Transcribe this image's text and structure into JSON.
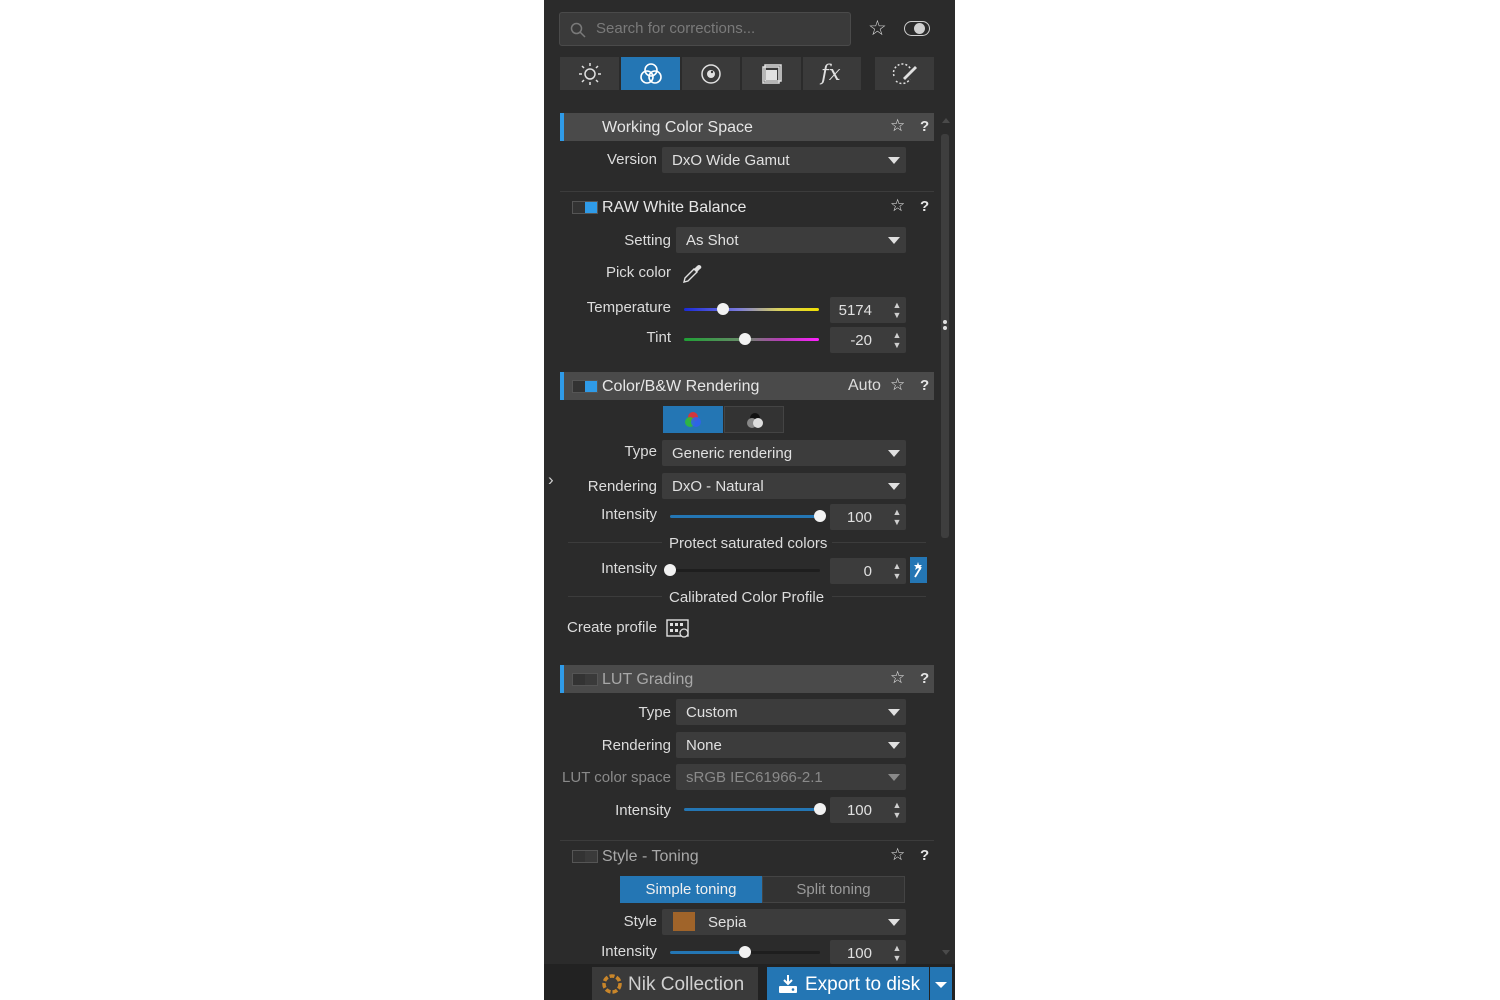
{
  "search": {
    "placeholder": "Search for corrections..."
  },
  "tabs": [
    {
      "icon": "sun-icon"
    },
    {
      "icon": "color-circles-icon"
    },
    {
      "icon": "lens-icon"
    },
    {
      "icon": "frames-icon"
    },
    {
      "icon": "fx-icon",
      "label": "fx"
    },
    {
      "icon": "local-adjust-icon"
    }
  ],
  "working_color_space": {
    "title": "Working Color Space",
    "version_label": "Version",
    "version_value": "DxO Wide Gamut"
  },
  "raw_white_balance": {
    "title": "RAW White Balance",
    "setting_label": "Setting",
    "setting_value": "As Shot",
    "pick_color_label": "Pick color",
    "temperature_label": "Temperature",
    "temperature_value": "5174",
    "temperature_fraction": 0.29,
    "tint_label": "Tint",
    "tint_value": "-20",
    "tint_fraction": 0.45
  },
  "color_rendering": {
    "title": "Color/B&W Rendering",
    "auto_label": "Auto",
    "type_label": "Type",
    "type_value": "Generic rendering",
    "rendering_label": "Rendering",
    "rendering_value": "DxO - Natural",
    "intensity_label": "Intensity",
    "intensity_value": "100",
    "protect_label": "Protect saturated colors",
    "protect_intensity_label": "Intensity",
    "protect_intensity_value": "0",
    "calibrated_label": "Calibrated Color Profile",
    "create_profile_label": "Create profile"
  },
  "lut_grading": {
    "title": "LUT Grading",
    "type_label": "Type",
    "type_value": "Custom",
    "rendering_label": "Rendering",
    "rendering_value": "None",
    "color_space_label": "LUT color space",
    "color_space_value": "sRGB IEC61966-2.1",
    "intensity_label": "Intensity",
    "intensity_value": "100"
  },
  "style_toning": {
    "title": "Style - Toning",
    "simple_label": "Simple toning",
    "split_label": "Split toning",
    "style_label": "Style",
    "style_value": "Sepia",
    "style_color": "#a0642a",
    "intensity_label": "Intensity",
    "intensity_value": "100",
    "intensity_fraction": 0.5
  },
  "footer": {
    "nik_label": "Nik Collection",
    "export_label": "Export to disk"
  },
  "colors": {
    "accent": "#2f9be8",
    "panel": "#2b2b2b",
    "selected_tab": "#2476b4"
  }
}
